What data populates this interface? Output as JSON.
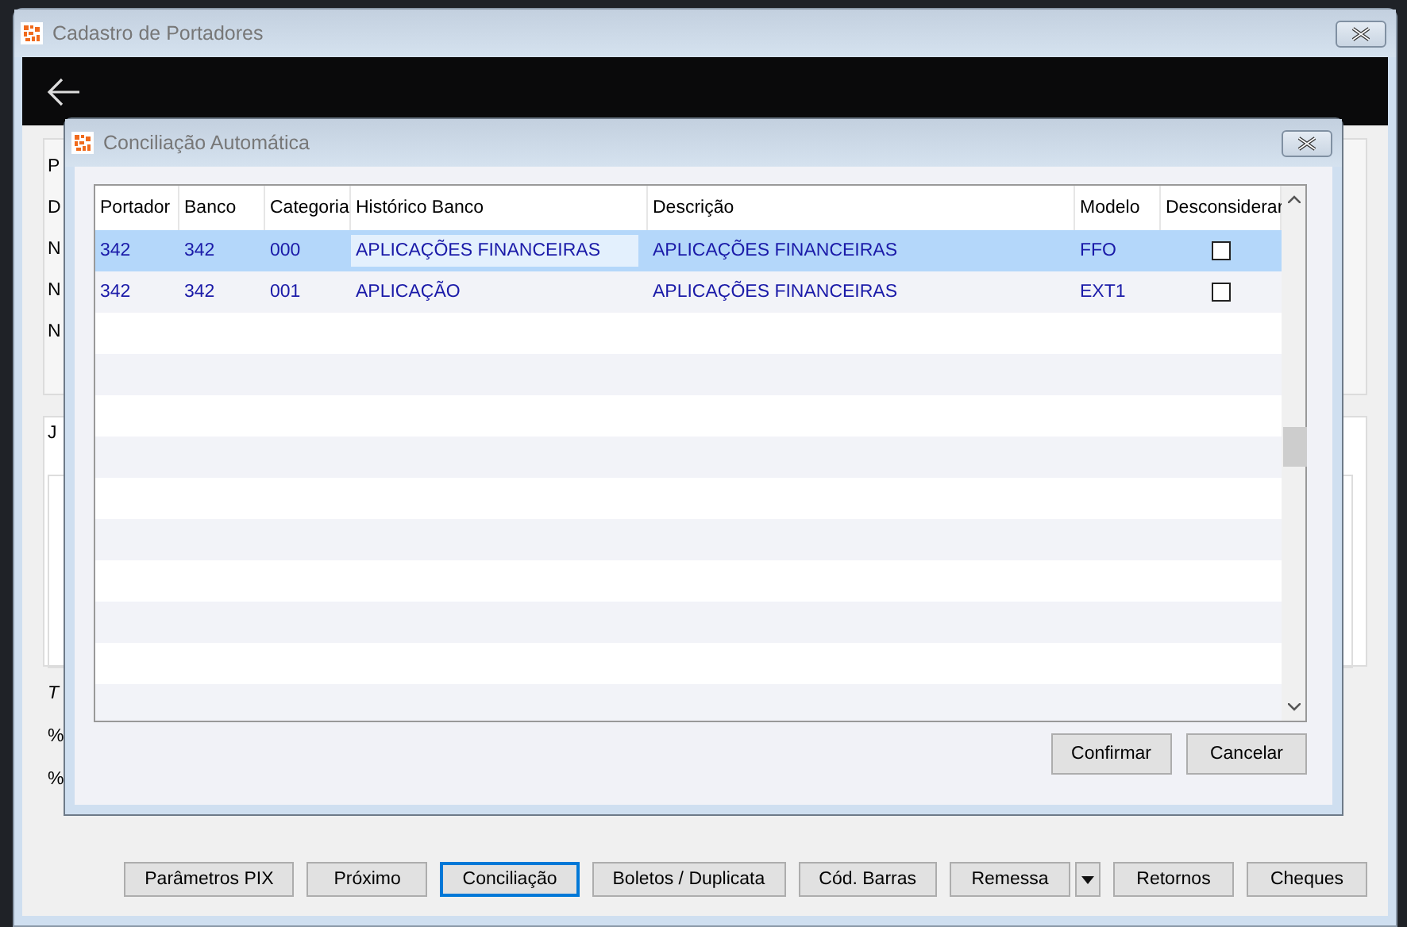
{
  "window": {
    "title": "Cadastro de Portadores",
    "upper_labels": [
      "P",
      "D",
      "N",
      "N",
      "N"
    ],
    "tab_label": "J",
    "footer_labels": [
      {
        "text": "T",
        "italic": true
      },
      {
        "text": "%",
        "italic": false
      },
      {
        "text": "%",
        "italic": false
      }
    ],
    "buttons": [
      {
        "label": "Parâmetros PIX",
        "focused": false,
        "dropdown": false
      },
      {
        "label": "Próximo",
        "focused": false,
        "dropdown": false
      },
      {
        "label": "Conciliação",
        "focused": true,
        "dropdown": false
      },
      {
        "label": "Boletos / Duplicata",
        "focused": false,
        "dropdown": false
      },
      {
        "label": "Cód. Barras",
        "focused": false,
        "dropdown": false
      },
      {
        "label": "Remessa",
        "focused": false,
        "dropdown": true
      },
      {
        "label": "Retornos",
        "focused": false,
        "dropdown": false
      },
      {
        "label": "Cheques",
        "focused": false,
        "dropdown": false
      }
    ]
  },
  "dialog": {
    "title": "Conciliação Automática",
    "table": {
      "columns": [
        "Portador",
        "Banco",
        "Categoria",
        "Histórico Banco",
        "Descrição",
        "Modelo",
        "Desconsiderar"
      ],
      "rows": [
        {
          "selected": true,
          "checked": false,
          "cells": [
            {
              "text": "342",
              "focused": false
            },
            {
              "text": "342",
              "focused": false
            },
            {
              "text": "000",
              "focused": false
            },
            {
              "text": "APLICAÇÕES FINANCEIRAS",
              "focused": true
            },
            {
              "text": "APLICAÇÕES FINANCEIRAS",
              "focused": false
            },
            {
              "text": "FFO",
              "focused": false
            }
          ]
        },
        {
          "selected": false,
          "checked": false,
          "cells": [
            {
              "text": "342",
              "focused": false
            },
            {
              "text": "342",
              "focused": false
            },
            {
              "text": "001",
              "focused": false
            },
            {
              "text": "APLICAÇÃO",
              "focused": false
            },
            {
              "text": "APLICAÇÕES FINANCEIRAS",
              "focused": false
            },
            {
              "text": "EXT1",
              "focused": false
            }
          ]
        }
      ]
    },
    "buttons": [
      "Confirmar",
      "Cancelar"
    ]
  }
}
